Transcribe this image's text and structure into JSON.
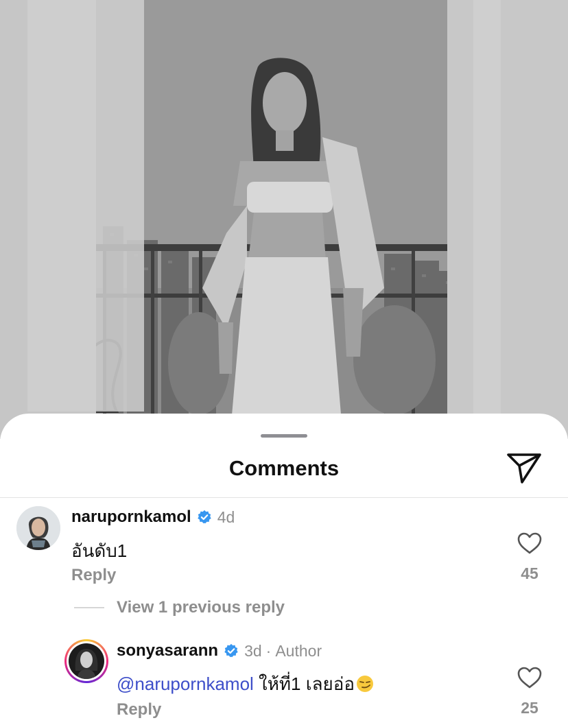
{
  "photo": {
    "description_icon": "photo-post"
  },
  "sheet": {
    "title": "Comments",
    "share_icon": "send-icon"
  },
  "comments": [
    {
      "username": "narupornkamol",
      "verified": true,
      "time": "4d",
      "text": "อันดับ1",
      "reply_label": "Reply",
      "likes": "45",
      "view_replies_label": "View 1 previous reply"
    }
  ],
  "reply": {
    "username": "sonyasarann",
    "verified": true,
    "time": "3d",
    "separator": "·",
    "role": "Author",
    "mention": "@narupornkamol",
    "text": " ให้ที่1 เลยอ่อ",
    "emoji": "smirk-emoji",
    "reply_label": "Reply",
    "likes": "25"
  },
  "colors": {
    "mention": "#3d4ec9",
    "verified": "#3897f0",
    "muted": "#8e8e8e",
    "story_ring": [
      "#f9ce34",
      "#ee2a7b",
      "#6228d7"
    ]
  }
}
